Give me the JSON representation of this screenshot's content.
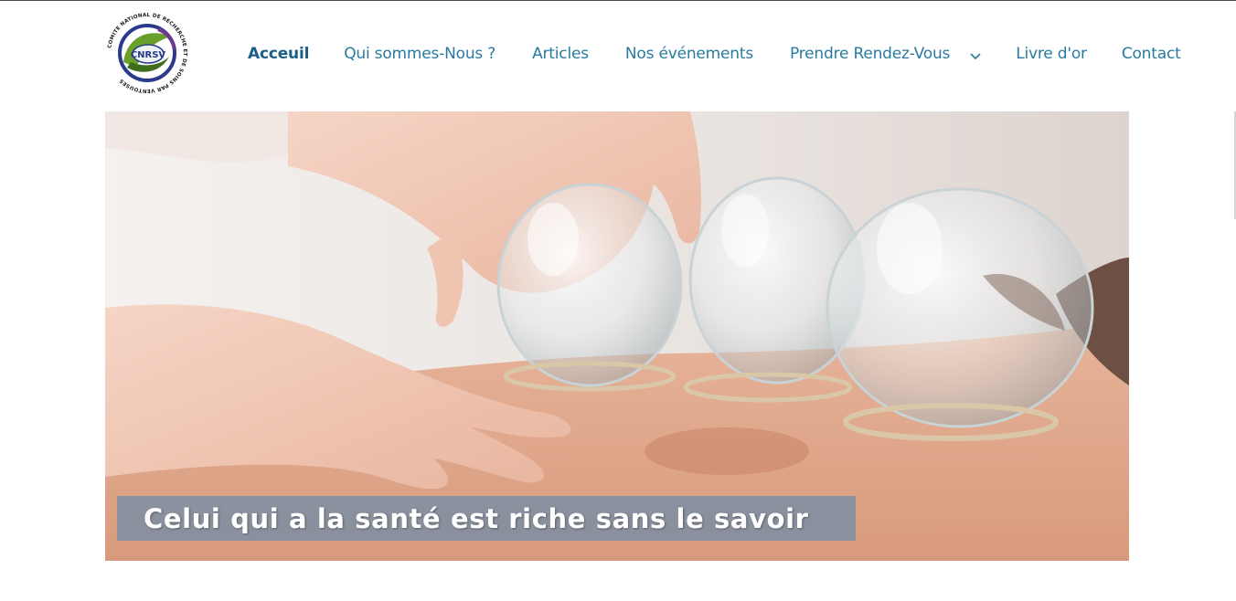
{
  "header": {
    "logo": {
      "center_text": "CNRSV",
      "ring_text": "COMITE NATIONAL DE RECHERCHE ET DE SOINS PAR VENTOUSES",
      "colors": {
        "ring": "#2b3a8c",
        "leaf_green": "#6a9f2a",
        "leaf_dark": "#3f6d1e",
        "purple": "#6b3a8e"
      }
    },
    "nav": {
      "items": [
        {
          "label": "Acceuil",
          "active": true
        },
        {
          "label": "Qui sommes-Nous ?",
          "active": false
        },
        {
          "label": "Articles",
          "active": false
        },
        {
          "label": "Nos événements",
          "active": false
        },
        {
          "label": "Prendre Rendez-Vous",
          "active": false,
          "has_dropdown": true,
          "dropdown_icon": "chevron-down-icon"
        },
        {
          "label": "Livre d'or",
          "active": false
        },
        {
          "label": "Contact",
          "active": false
        }
      ]
    }
  },
  "hero": {
    "image_subject": "glass-cupping-therapy",
    "caption": "Celui qui a la santé est riche sans le savoir"
  },
  "colors": {
    "nav_link": "#2a7aa0",
    "nav_active": "#1b5e86",
    "caption_bg": "#788ea5",
    "caption_text": "#ffffff"
  }
}
